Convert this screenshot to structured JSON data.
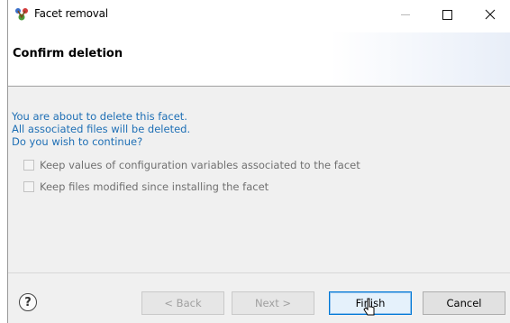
{
  "window": {
    "title": "Facet removal",
    "icon": "facet-app-icon"
  },
  "header": {
    "title": "Confirm deletion"
  },
  "content": {
    "messages": [
      "You are about to delete this facet.",
      "All associated files will be deleted.",
      "Do you wish to continue?"
    ],
    "options": [
      {
        "label": "Keep values of configuration variables associated to the facet",
        "checked": false,
        "enabled": false
      },
      {
        "label": "Keep files modified since installing the facet",
        "checked": false,
        "enabled": false
      }
    ]
  },
  "footer": {
    "help_icon": "help-icon",
    "back_label": "< Back",
    "next_label": "Next >",
    "finish_label": "Finish",
    "cancel_label": "Cancel"
  },
  "colors": {
    "message_text": "#1e6fb5",
    "default_button_border": "#0078d7"
  }
}
